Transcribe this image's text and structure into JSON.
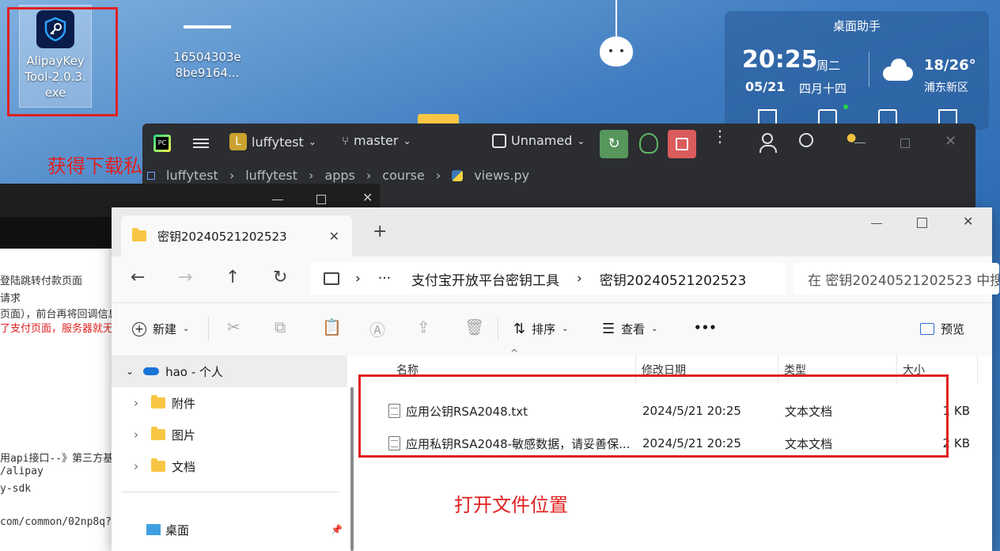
{
  "desktop": {
    "icon1_label": "AlipayKeyTool-2.0.3.exe",
    "icon2_label": "16504303e8be9164...",
    "annotation1": "获得下载私钥的工具包",
    "annotation2": "打开文件位置"
  },
  "widget": {
    "title": "桌面助手",
    "time": "20:25",
    "weekday": "周二",
    "date": "05/21",
    "lunar": "四月十四",
    "temp": "18/26°",
    "location": "浦东新区"
  },
  "ide": {
    "project_initial": "L",
    "project": "luffytest",
    "branch": "master",
    "run_config": "Unnamed",
    "breadcrumbs": [
      "luffytest",
      "luffytest",
      "apps",
      "course",
      "views.py"
    ]
  },
  "browser_bg": {
    "lines": [
      "登陆跳转付款页面",
      "请求",
      "页面），前台再将回调信息",
      "了支付页面，服务器就无",
      "用api接口--》第三方基于",
      "/alipay",
      "y-sdk",
      "com/common/02np8q?"
    ]
  },
  "explorer": {
    "tab_title": "密钥20240521202523",
    "new_tab": "+",
    "path": [
      "支付宝开放平台密钥工具",
      "密钥20240521202523"
    ],
    "search_placeholder": "在 密钥20240521202523 中搜索",
    "cmd": {
      "new": "新建",
      "sort": "排序",
      "view": "查看",
      "more": "•••",
      "preview": "预览"
    },
    "sidebar": {
      "account": "hao - 个人",
      "folders": [
        "附件",
        "图片",
        "文档"
      ],
      "pinned": "桌面"
    },
    "columns": {
      "name": "名称",
      "modified": "修改日期",
      "type": "类型",
      "size": "大小"
    },
    "files": [
      {
        "name": "应用公钥RSA2048.txt",
        "modified": "2024/5/21 20:25",
        "type": "文本文档",
        "size": "1 KB"
      },
      {
        "name": "应用私钥RSA2048-敏感数据，请妥善保...",
        "modified": "2024/5/21 20:25",
        "type": "文本文档",
        "size": "2 KB"
      }
    ]
  }
}
